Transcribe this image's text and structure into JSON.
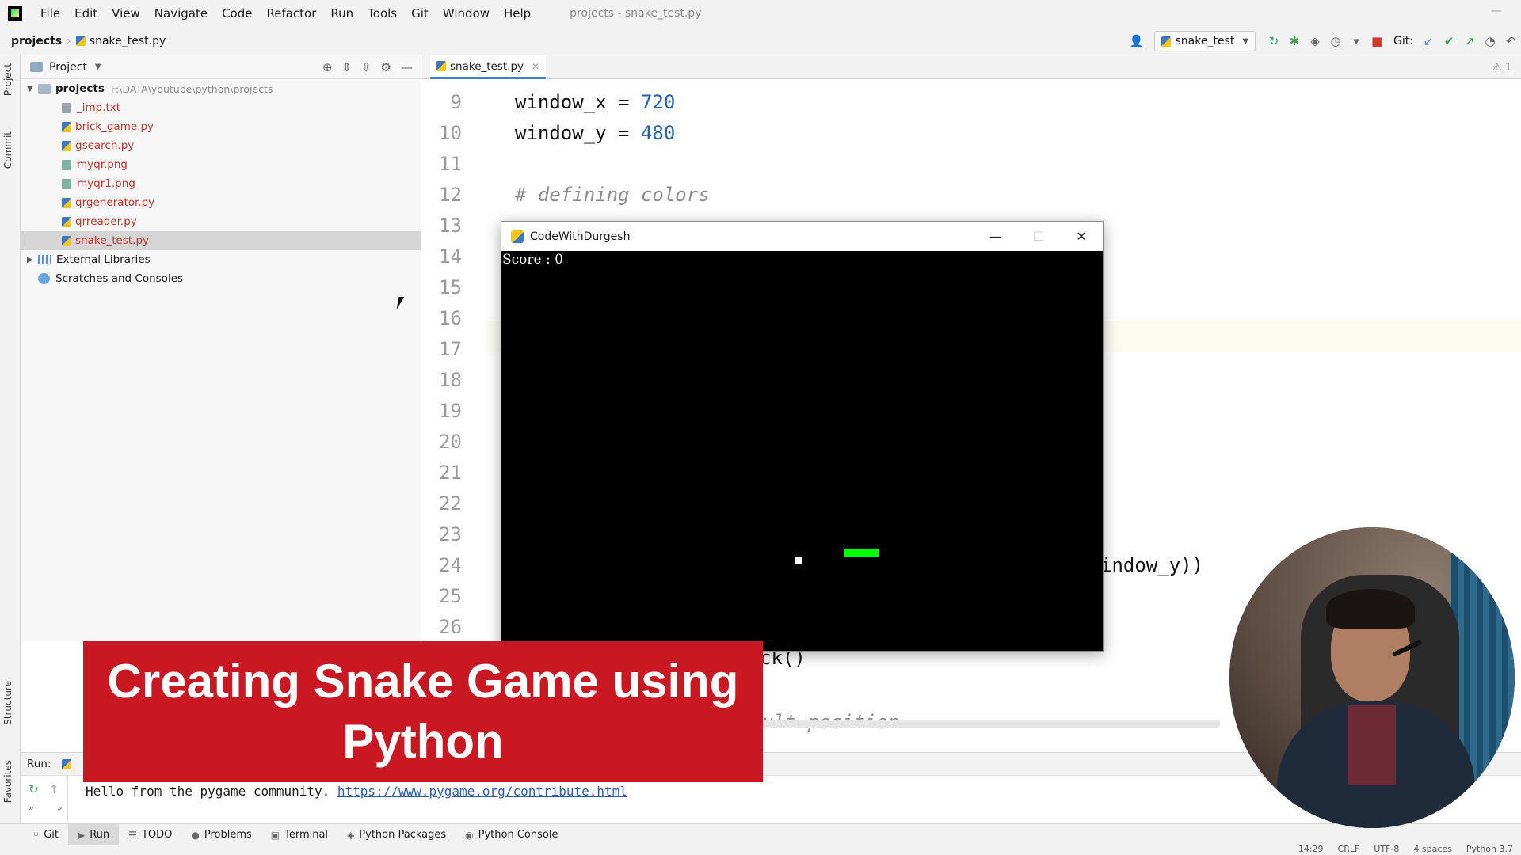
{
  "menubar": {
    "items": [
      "File",
      "Edit",
      "View",
      "Navigate",
      "Code",
      "Refactor",
      "Run",
      "Tools",
      "Git",
      "Window",
      "Help"
    ],
    "title": "projects - snake_test.py",
    "minimize": "—"
  },
  "breadcrumb": {
    "root": "projects",
    "file": "snake_test.py"
  },
  "toolbar": {
    "run_config": "snake_test",
    "git_label": "Git:"
  },
  "left_stripe": {
    "project": "Project",
    "commit": "Commit",
    "structure": "Structure",
    "favorites": "Favorites"
  },
  "project_panel": {
    "title": "Project",
    "root": {
      "name": "projects",
      "path": "F:\\DATA\\youtube\\python\\projects"
    },
    "files": [
      "_imp.txt",
      "brick_game.py",
      "gsearch.py",
      "myqr.png",
      "myqr1.png",
      "qrgenerator.py",
      "qrreader.py",
      "snake_test.py"
    ],
    "selected_file": "snake_test.py",
    "external_libraries": "External Libraries",
    "scratches": "Scratches and Consoles"
  },
  "editor": {
    "tab": "snake_test.py",
    "warnings": "⚠ 1",
    "line_numbers": [
      "9",
      "10",
      "11",
      "12",
      "13",
      "14",
      "15",
      "16",
      "17",
      "18",
      "19",
      "20",
      "21",
      "22",
      "23",
      "24",
      "25",
      "26"
    ],
    "code": {
      "l9_var": "window_x = ",
      "l9_num": "720",
      "l10_var": "window_y = ",
      "l10_num": "480",
      "l12_comment": "# defining colors",
      "l24_tail": "indow_y))",
      "l27_tail": "ck()",
      "l29_tail": "ult position"
    }
  },
  "game_window": {
    "title": "CodeWithDurgesh",
    "score_text": "Score : 0",
    "snake_color": "#00ff00",
    "food_color": "#ffffff"
  },
  "run_panel": {
    "label": "Run:",
    "output_text": "Hello from the pygame community. ",
    "output_link": "https://www.pygame.org/contribute.html"
  },
  "bottom_tabs": [
    "Git",
    "Run",
    "TODO",
    "Problems",
    "Terminal",
    "Python Packages",
    "Python Console"
  ],
  "active_bottom_tab": "Run",
  "status": {
    "position": "14:29",
    "line_sep": "CRLF",
    "encoding": "UTF-8",
    "indent": "4 spaces",
    "interpreter": "Python 3.7"
  },
  "overlay": {
    "title": "Creating Snake Game using Python",
    "banner_color": "#c91822"
  }
}
